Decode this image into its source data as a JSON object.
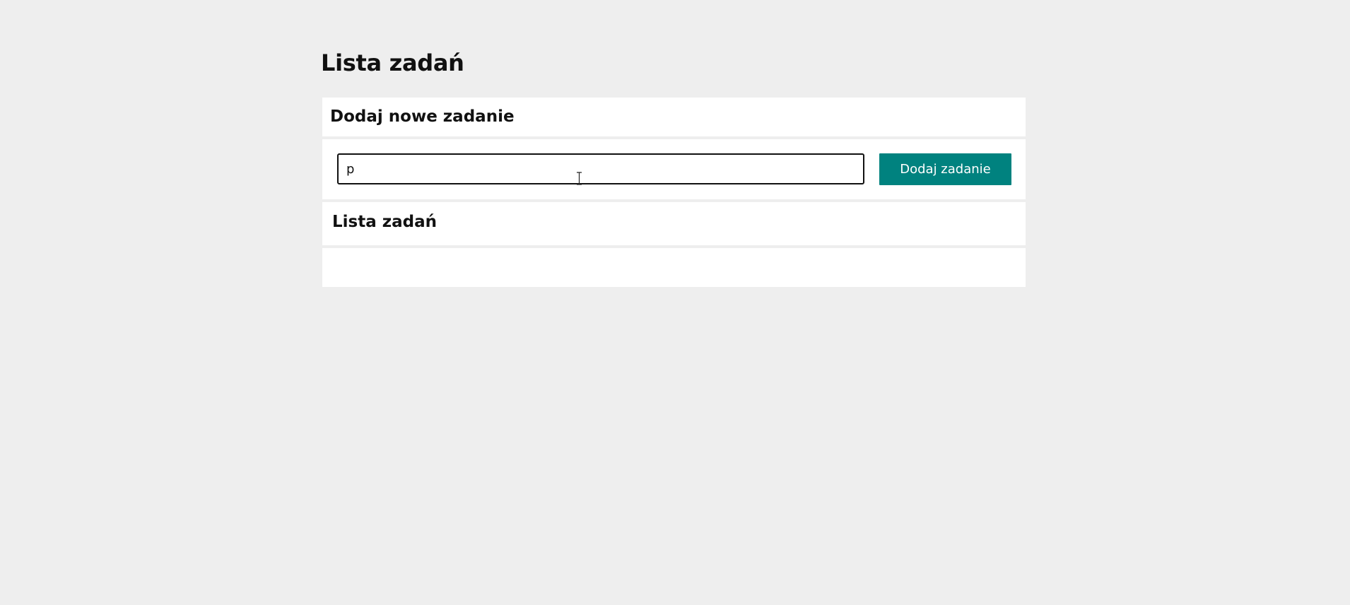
{
  "page": {
    "title": "Lista zadań"
  },
  "add_section": {
    "heading": "Dodaj nowe zadanie",
    "input_value": "p",
    "button_label": "Dodaj zadanie"
  },
  "list_section": {
    "heading": "Lista zadań",
    "items": []
  },
  "colors": {
    "background": "#eeeeee",
    "panel": "#ffffff",
    "accent": "#00827f",
    "text": "#111111"
  },
  "icons": {
    "cursor": "text-cursor-icon"
  }
}
